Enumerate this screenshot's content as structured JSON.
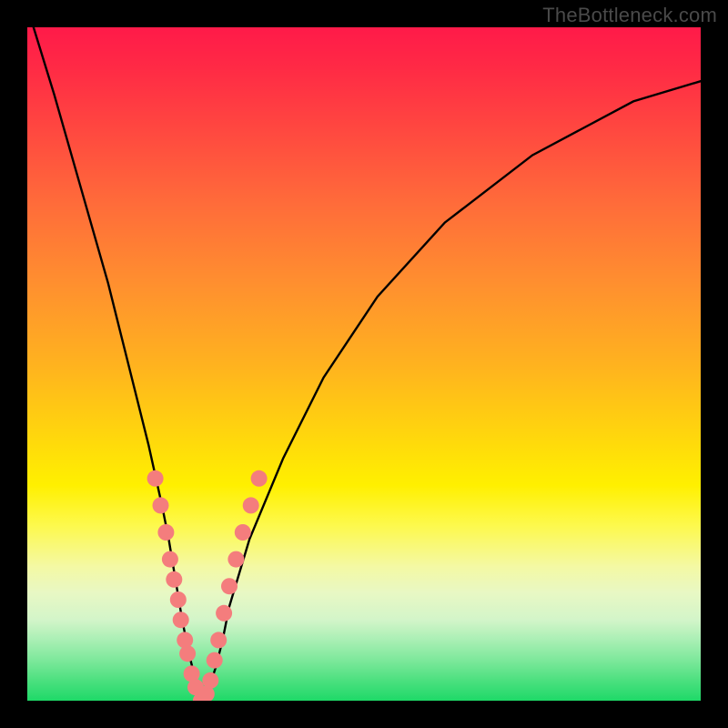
{
  "watermark": "TheBottleneck.com",
  "chart_data": {
    "type": "line",
    "title": "",
    "xlabel": "",
    "ylabel": "",
    "xlim": [
      0,
      100
    ],
    "ylim": [
      0,
      100
    ],
    "series": [
      {
        "name": "bottleneck-curve",
        "x": [
          0,
          4,
          8,
          12,
          14,
          16,
          18,
          20,
          21,
          22,
          23,
          24,
          25,
          26,
          27,
          28,
          29,
          30,
          33,
          38,
          44,
          52,
          62,
          75,
          90,
          100
        ],
        "values": [
          103,
          90,
          76,
          62,
          54,
          46,
          38,
          29,
          24,
          18,
          12,
          7,
          3,
          0,
          2,
          5,
          9,
          14,
          24,
          36,
          48,
          60,
          71,
          81,
          89,
          92
        ]
      }
    ],
    "markers": {
      "name": "highlight-dots",
      "color": "#f47d7d",
      "points": [
        {
          "x": 19.0,
          "y": 33
        },
        {
          "x": 19.8,
          "y": 29
        },
        {
          "x": 20.6,
          "y": 25
        },
        {
          "x": 21.2,
          "y": 21
        },
        {
          "x": 21.8,
          "y": 18
        },
        {
          "x": 22.4,
          "y": 15
        },
        {
          "x": 22.8,
          "y": 12
        },
        {
          "x": 23.4,
          "y": 9
        },
        {
          "x": 23.8,
          "y": 7
        },
        {
          "x": 24.4,
          "y": 4
        },
        {
          "x": 25.0,
          "y": 2
        },
        {
          "x": 25.8,
          "y": 0
        },
        {
          "x": 26.6,
          "y": 1
        },
        {
          "x": 27.2,
          "y": 3
        },
        {
          "x": 27.8,
          "y": 6
        },
        {
          "x": 28.4,
          "y": 9
        },
        {
          "x": 29.2,
          "y": 13
        },
        {
          "x": 30.0,
          "y": 17
        },
        {
          "x": 31.0,
          "y": 21
        },
        {
          "x": 32.0,
          "y": 25
        },
        {
          "x": 33.2,
          "y": 29
        },
        {
          "x": 34.4,
          "y": 33
        }
      ]
    }
  }
}
